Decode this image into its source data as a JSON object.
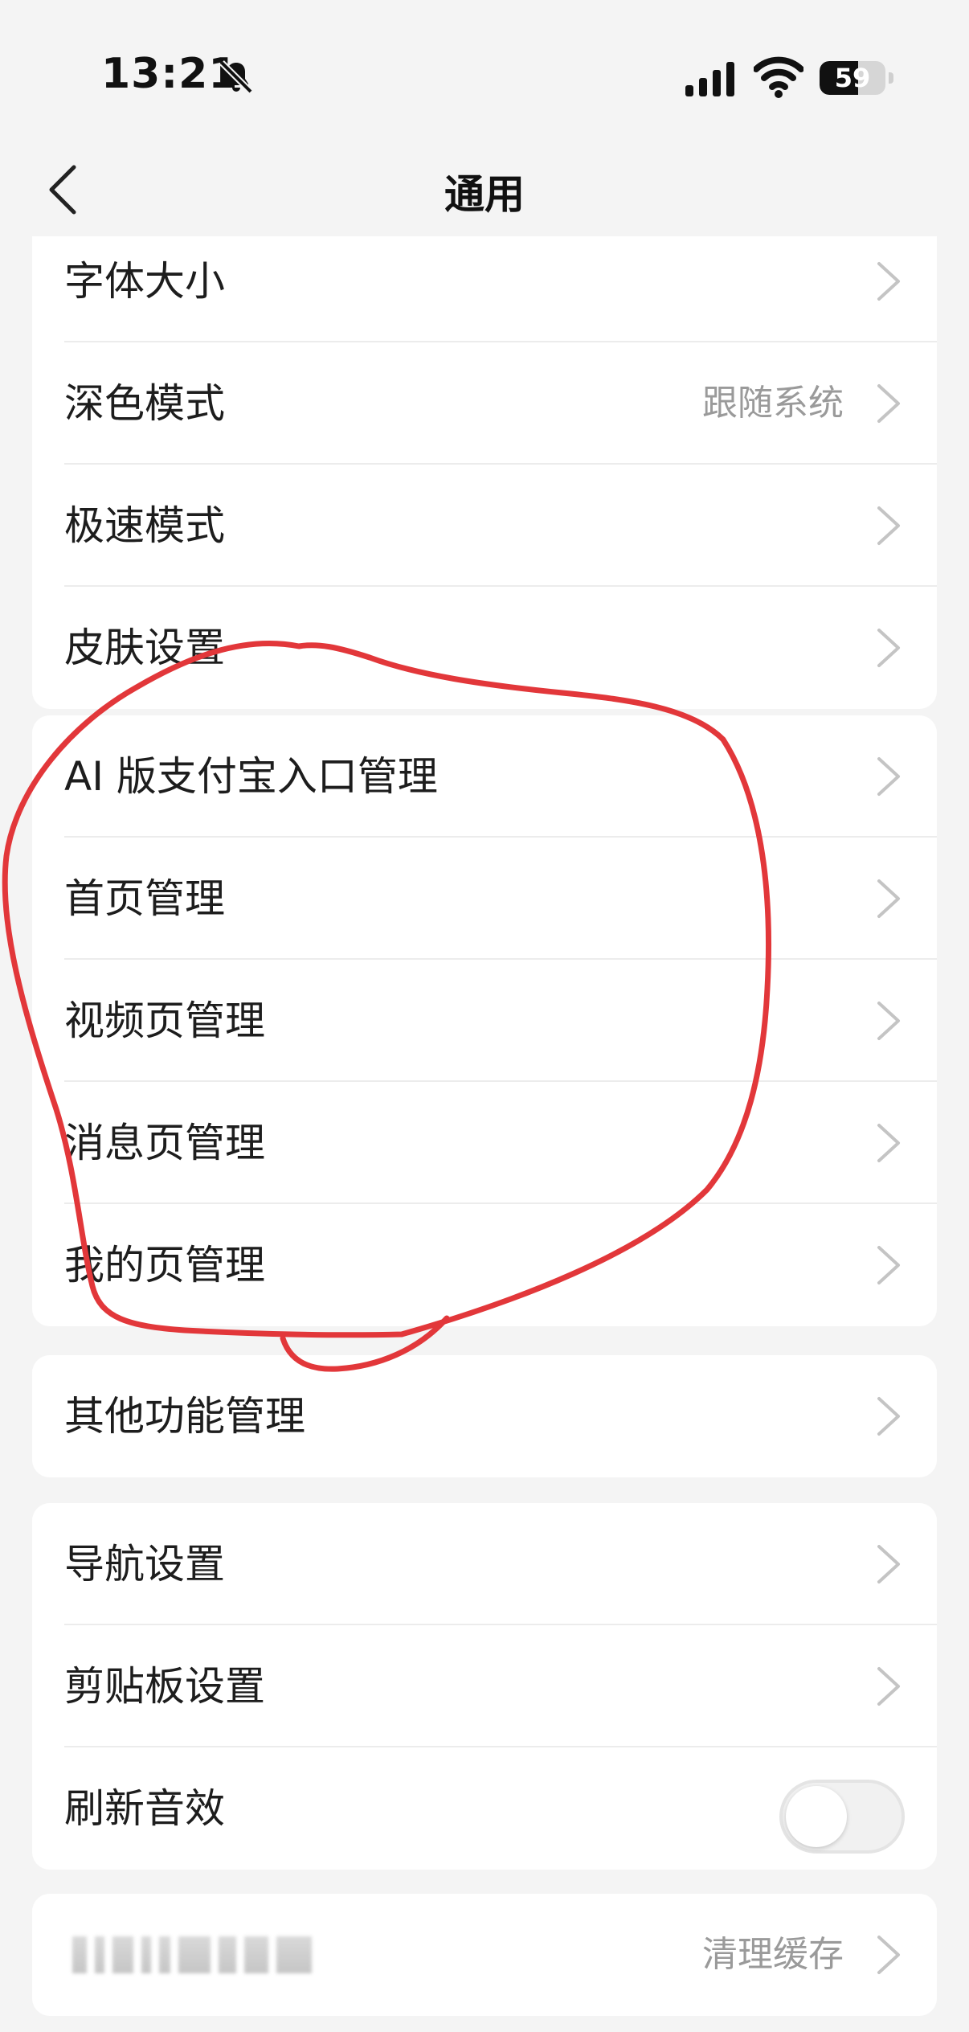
{
  "status_bar": {
    "time": "13:21",
    "battery": "59",
    "battery_level": 0.59
  },
  "nav": {
    "title": "通用"
  },
  "groups": [
    {
      "rows": [
        {
          "label": "字体大小",
          "value": "",
          "type": "link"
        },
        {
          "label": "深色模式",
          "value": "跟随系统",
          "type": "link"
        },
        {
          "label": "极速模式",
          "value": "",
          "type": "link"
        },
        {
          "label": "皮肤设置",
          "value": "",
          "type": "link"
        }
      ]
    },
    {
      "rows": [
        {
          "label": "AI 版支付宝入口管理",
          "value": "",
          "type": "link"
        },
        {
          "label": "首页管理",
          "value": "",
          "type": "link"
        },
        {
          "label": "视频页管理",
          "value": "",
          "type": "link"
        },
        {
          "label": "消息页管理",
          "value": "",
          "type": "link"
        },
        {
          "label": "我的页管理",
          "value": "",
          "type": "link"
        }
      ]
    },
    {
      "rows": [
        {
          "label": "其他功能管理",
          "value": "",
          "type": "link"
        }
      ]
    },
    {
      "rows": [
        {
          "label": "导航设置",
          "value": "",
          "type": "link"
        },
        {
          "label": "剪贴板设置",
          "value": "",
          "type": "link"
        },
        {
          "label": "刷新音效",
          "value": "",
          "type": "toggle",
          "on": false
        }
      ]
    },
    {
      "rows": [
        {
          "label": "",
          "value": "清理缓存",
          "type": "link",
          "blurred": true
        }
      ]
    }
  ],
  "colors": {
    "background": "#f4f4f4",
    "card": "#ffffff",
    "secondary_text": "#9a9a9a",
    "annotation": "#e2373a"
  },
  "icons": {
    "back": "chevron-left-icon",
    "row": "chevron-right-icon",
    "mute": "bell-slash-icon",
    "signal": "cellular-signal-icon",
    "wifi": "wifi-icon"
  }
}
